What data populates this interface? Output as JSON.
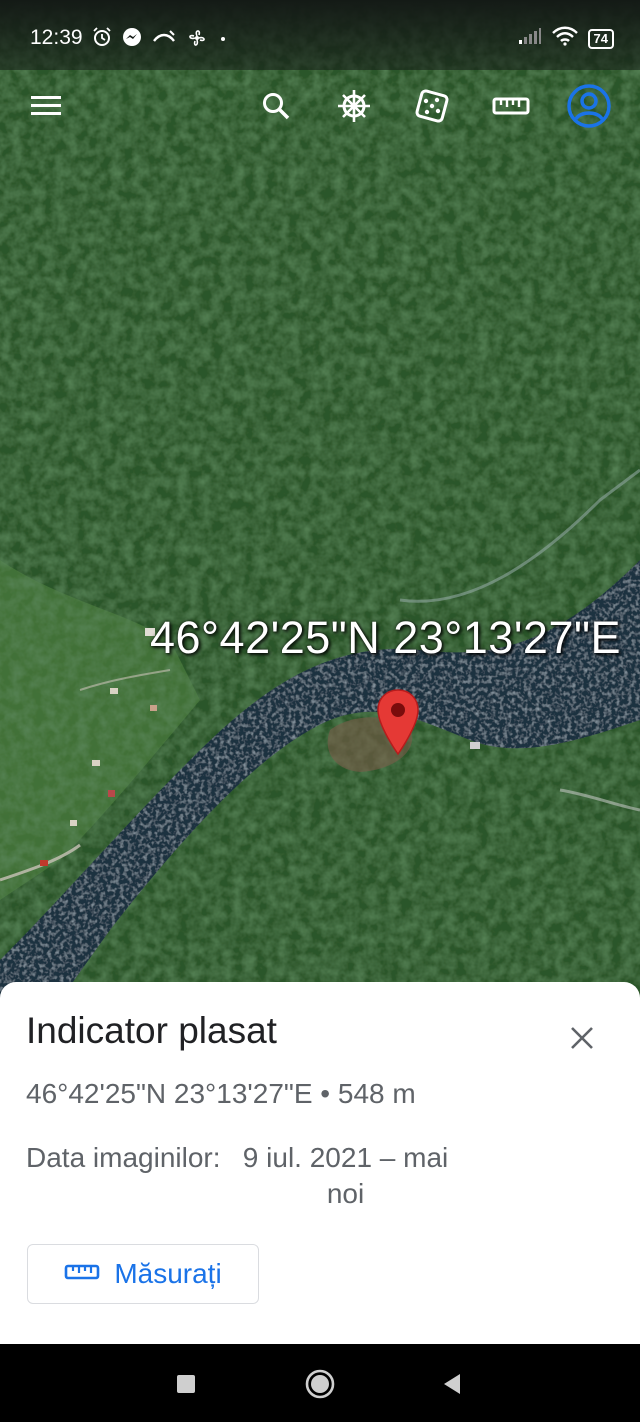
{
  "status_bar": {
    "time": "12:39",
    "battery": "74",
    "left_icons": [
      "alarm-icon",
      "messenger-icon",
      "missed-call-icon",
      "fan-icon",
      "dot-icon"
    ],
    "right_icons": [
      "signal-icon",
      "wifi-icon",
      "battery-icon"
    ]
  },
  "toolbar": {
    "icons": [
      "menu-icon",
      "search-icon",
      "voyager-wheel-icon",
      "dice-icon",
      "ruler-icon",
      "account-icon"
    ]
  },
  "map": {
    "coordinate_label": "46°42'25\"N 23°13'27\"E",
    "pin_color": "#e53935"
  },
  "sheet": {
    "title": "Indicator plasat",
    "coordinates": "46°42'25\"N 23°13'27\"E • 548 m",
    "date_label": "Data imaginilor:",
    "date_value": "9 iul. 2021 – mai noi",
    "measure_button": "Măsurați"
  },
  "colors": {
    "accent": "#1a73e8",
    "forest": "#2f5a2c",
    "river": "#1b2f3c"
  },
  "nav_bar": {
    "icons": [
      "recents-icon",
      "home-icon",
      "back-icon"
    ]
  }
}
